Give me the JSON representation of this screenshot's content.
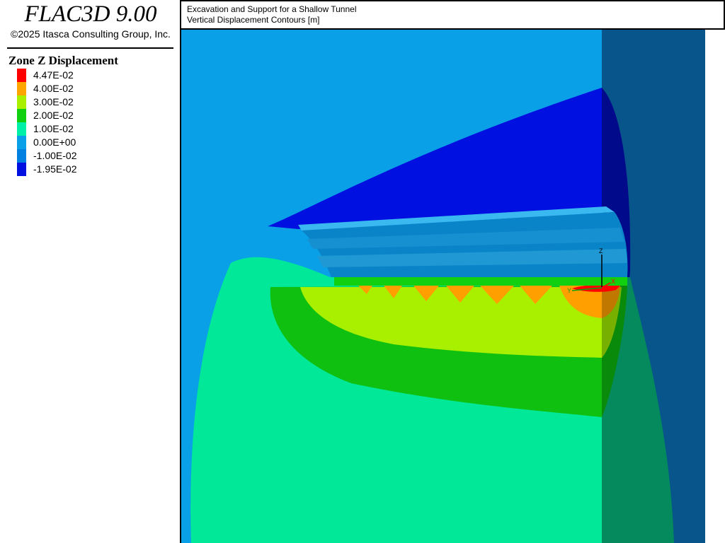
{
  "app": {
    "title": "FLAC3D 9.00",
    "copyright": "©2025 Itasca Consulting Group, Inc."
  },
  "legend": {
    "title": "Zone Z Displacement",
    "items": [
      {
        "label": "4.47E-02",
        "color": "#ff0000"
      },
      {
        "label": "4.00E-02",
        "color": "#ffa500"
      },
      {
        "label": "3.00E-02",
        "color": "#a8f000"
      },
      {
        "label": "2.00E-02",
        "color": "#10d010"
      },
      {
        "label": "1.00E-02",
        "color": "#00f0a8"
      },
      {
        "label": "0.00E+00",
        "color": "#0aa0e8"
      },
      {
        "label": "-1.00E-02",
        "color": "#0080e0"
      },
      {
        "label": "-1.95E-02",
        "color": "#0010e0"
      }
    ]
  },
  "plot": {
    "title_line1": "Excavation and Support for a Shallow Tunnel",
    "title_line2": "Vertical Displacement Contours [m]"
  },
  "axes": {
    "z_label": "Z",
    "y_label": "Y",
    "x_label": "X"
  }
}
